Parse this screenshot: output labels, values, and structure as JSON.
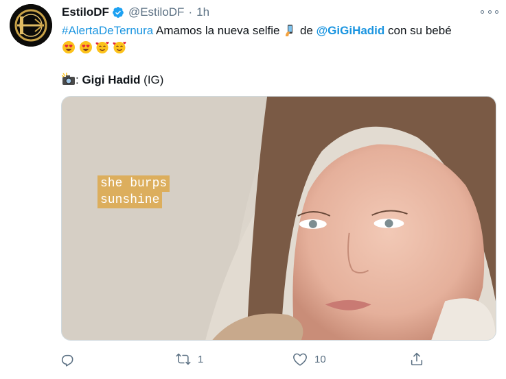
{
  "tweet": {
    "author_name": "EstiloDF",
    "author_handle": "@EstiloDF",
    "separator": "·",
    "time": "1h",
    "text_hashtag": "#AlertaDeTernura",
    "text_part1": " Amamos la nueva selfie ",
    "text_part2": " de ",
    "text_mention": "@GiGiHadid",
    "text_part3": " con su bebé",
    "credit_suffix": ": ",
    "credit_name": "Gigi Hadid",
    "credit_source": " (IG)",
    "media": {
      "sticker_line1": "she burps",
      "sticker_line2": "sunshine"
    },
    "actions": {
      "reply_count": "",
      "retweet_count": "1",
      "like_count": "10"
    }
  },
  "icons": {
    "avatar": "estilodf-logo",
    "verified": "verified-badge-icon",
    "more": "more-icon",
    "selfie": "selfie-emoji",
    "heart_eyes": "heart-eyes-emoji",
    "smiling_hearts": "smiling-face-with-hearts-emoji",
    "camera": "camera-flash-emoji",
    "reply": "reply-icon",
    "retweet": "retweet-icon",
    "like": "like-icon",
    "share": "share-icon"
  },
  "colors": {
    "link": "#1b95e0",
    "secondary_text": "#5b7083",
    "verified": "#1da1f2",
    "sticker_bg": "#ddaa4e"
  }
}
